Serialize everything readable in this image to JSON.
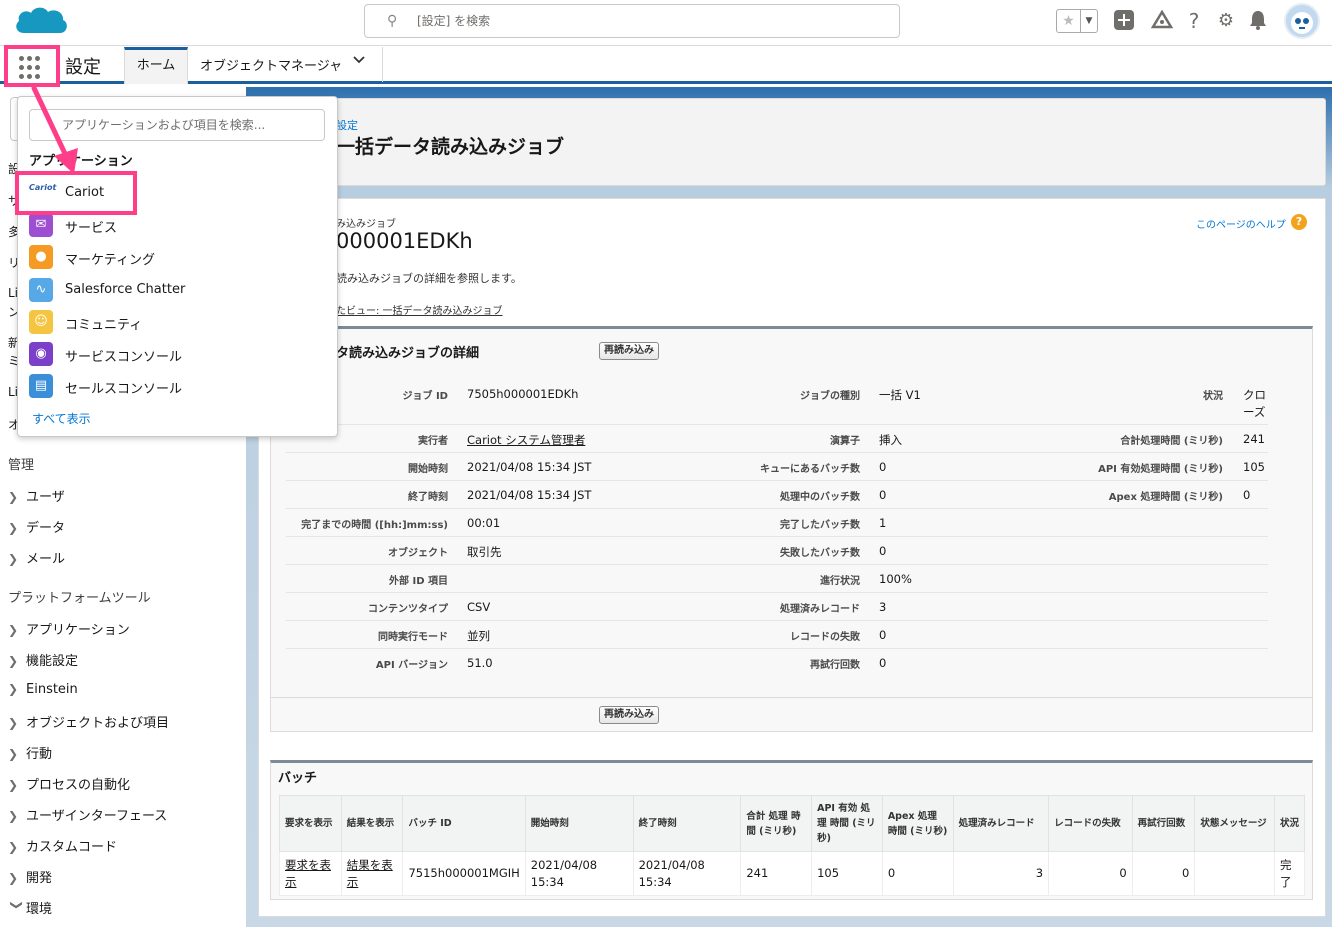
{
  "header": {
    "search_placeholder": "[設定] を検索",
    "icons": [
      "favorites-star-icon",
      "add-icon",
      "trailhead-icon",
      "help-icon",
      "setup-gear-icon",
      "notification-bell-icon"
    ]
  },
  "nav": {
    "app_name": "設定",
    "tabs": [
      {
        "label": "ホーム"
      },
      {
        "label": "オブジェクトマネージャ"
      }
    ]
  },
  "sidebar": {
    "peek_letters": [
      "設",
      "サ",
      "多",
      "リ",
      "Li",
      "ン",
      "新",
      "ミ",
      "Li",
      "オ"
    ],
    "sections": [
      {
        "title": "管理",
        "items": [
          "ユーザ",
          "データ",
          "メール"
        ]
      },
      {
        "title": "プラットフォームツール",
        "items": [
          "アプリケーション",
          "機能設定",
          "Einstein",
          "オブジェクトおよび項目",
          "行動",
          "プロセスの自動化",
          "ユーザインターフェース",
          "カスタムコード",
          "開発",
          "環境"
        ]
      }
    ]
  },
  "launcher": {
    "search_placeholder": "アプリケーションおよび項目を検索...",
    "section_title": "アプリケーション",
    "apps": [
      {
        "label": "Cariot",
        "icon": "cariot-logo-icon",
        "color": "#ffffff"
      },
      {
        "label": "サービス",
        "icon": "service-icon",
        "color": "#9e4fd1"
      },
      {
        "label": "マーケティング",
        "icon": "marketing-icon",
        "color": "#f59a23"
      },
      {
        "label": "Salesforce Chatter",
        "icon": "chatter-icon",
        "color": "#56a8e6"
      },
      {
        "label": "コミュニティ",
        "icon": "community-icon",
        "color": "#f5c542"
      },
      {
        "label": "サービスコンソール",
        "icon": "service-console-icon",
        "color": "#7b3fc9"
      },
      {
        "label": "セールスコンソール",
        "icon": "sales-console-icon",
        "color": "#3b8fd9"
      }
    ],
    "show_all": "すべて表示",
    "highlight_color": "#ff3e8a"
  },
  "page_header": {
    "breadcrumb": "設定",
    "title": "一括データ読み込みジョブ"
  },
  "job": {
    "subtitle": "み込みジョブ",
    "title": "000001EDKh",
    "description": "読み込みジョブの詳細を参照します。",
    "view_link": "たビュー: 一括データ読み込みジョブ",
    "help_link": "このページのヘルプ",
    "detail_title": "タ読み込みジョブの詳細",
    "reload_button": "再読み込み"
  },
  "details": {
    "col1": [
      {
        "label": "ジョブ ID",
        "value": "7505h000001EDKh"
      },
      {
        "label": "実行者",
        "value": "Cariot システム管理者"
      },
      {
        "label": "開始時刻",
        "value": "2021/04/08 15:34 JST"
      },
      {
        "label": "終了時刻",
        "value": "2021/04/08 15:34 JST"
      },
      {
        "label": "完了までの時間 ([hh:]mm:ss)",
        "value": "00:01"
      },
      {
        "label": "オブジェクト",
        "value": "取引先"
      },
      {
        "label": "外部 ID 項目",
        "value": ""
      },
      {
        "label": "コンテンツタイプ",
        "value": "CSV"
      },
      {
        "label": "同時実行モード",
        "value": "並列"
      },
      {
        "label": "API バージョン",
        "value": "51.0"
      }
    ],
    "col2": [
      {
        "label": "ジョブの種別",
        "value": "一括 V1"
      },
      {
        "label": "演算子",
        "value": "挿入"
      },
      {
        "label": "キューにあるバッチ数",
        "value": "0"
      },
      {
        "label": "処理中のバッチ数",
        "value": "0"
      },
      {
        "label": "完了したバッチ数",
        "value": "1"
      },
      {
        "label": "失敗したバッチ数",
        "value": "0"
      },
      {
        "label": "進行状況",
        "value": "100%"
      },
      {
        "label": "処理済みレコード",
        "value": "3"
      },
      {
        "label": "レコードの失敗",
        "value": "0"
      },
      {
        "label": "再試行回数",
        "value": "0"
      }
    ],
    "col3": [
      {
        "label": "状況",
        "value": "クローズ"
      },
      {
        "label": "合計処理時間 (ミリ秒)",
        "value": "241"
      },
      {
        "label": "API 有効処理時間 (ミリ秒)",
        "value": "105"
      },
      {
        "label": "Apex 処理時間 (ミリ秒)",
        "value": "0"
      }
    ]
  },
  "batch": {
    "title": "バッチ",
    "headers": [
      "要求を表示",
      "結果を表示",
      "バッチ ID",
      "開始時刻",
      "終了時刻",
      "合計 処理 時間 (ミリ秒)",
      "API 有効 処理 時間 (ミリ秒)",
      "Apex 処理 時間 (ミリ秒)",
      "処理済みレコード",
      "レコードの失敗",
      "再試行回数",
      "状態メッセージ",
      "状況"
    ],
    "rows": [
      {
        "request": "要求を表示",
        "result": "結果を表示",
        "batch_id": "7515h000001MGIH",
        "start": "2021/04/08 15:34",
        "end": "2021/04/08 15:34",
        "total": "241",
        "api": "105",
        "apex": "0",
        "processed": "3",
        "failed": "0",
        "retries": "0",
        "message": "",
        "status": "完了"
      }
    ]
  }
}
